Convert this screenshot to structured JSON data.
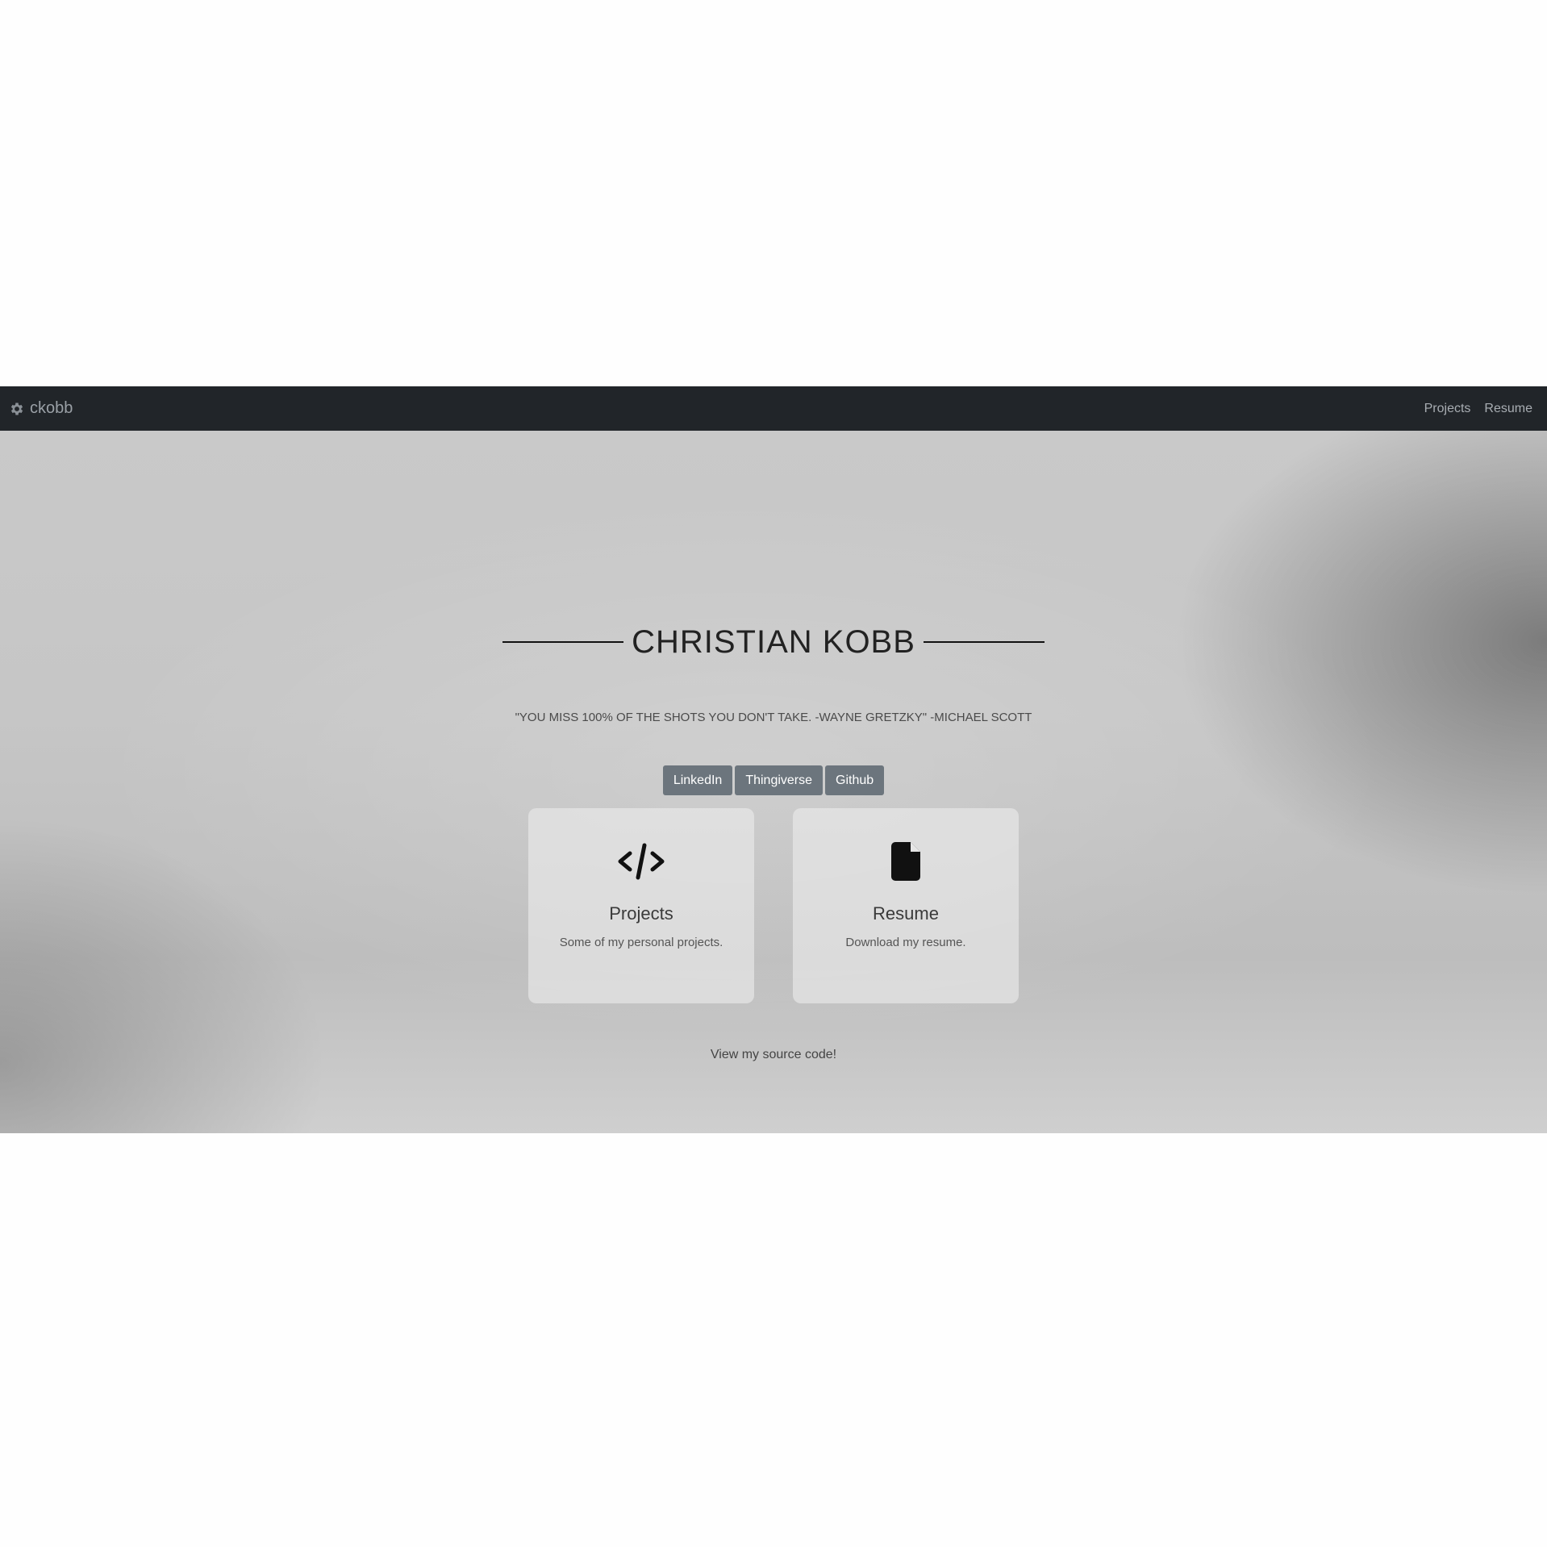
{
  "navbar": {
    "brand_label": "ckobb",
    "brand_icon": "gear-icon",
    "links": [
      {
        "label": "Projects"
      },
      {
        "label": "Resume"
      }
    ],
    "background": "#212529"
  },
  "hero": {
    "title": "CHRISTIAN KOBB",
    "quote": "\"YOU MISS 100% OF THE SHOTS YOU DON'T TAKE. -WAYNE GRETZKY\" -MICHAEL SCOTT",
    "social_buttons": [
      {
        "label": "LinkedIn"
      },
      {
        "label": "Thingiverse"
      },
      {
        "label": "Github"
      }
    ],
    "button_color": "#6c757d",
    "cards": [
      {
        "icon": "code-icon",
        "title": "Projects",
        "description": "Some of my personal projects."
      },
      {
        "icon": "file-icon",
        "title": "Resume",
        "description": "Download my resume."
      }
    ],
    "source_link": "View my source code!"
  }
}
